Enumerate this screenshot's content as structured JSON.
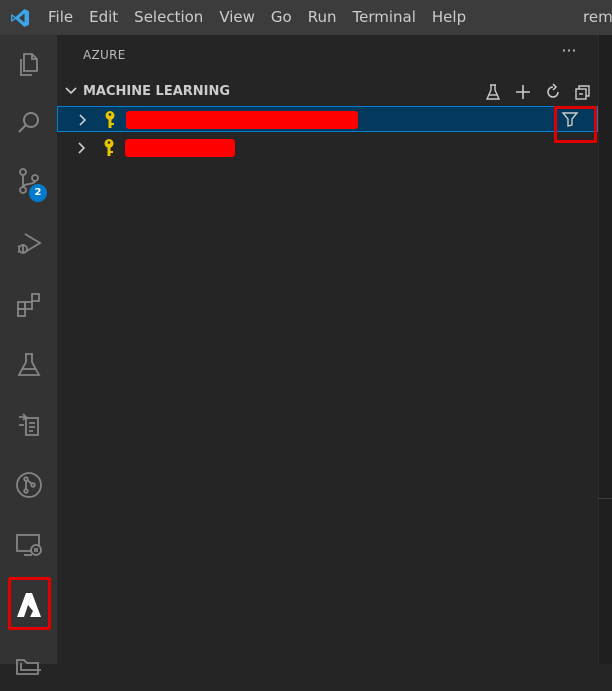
{
  "menubar": {
    "items": [
      "File",
      "Edit",
      "Selection",
      "View",
      "Go",
      "Run",
      "Terminal",
      "Help"
    ],
    "window_title": "remo"
  },
  "activitybar": {
    "items": [
      {
        "name": "explorer",
        "icon": "files-icon"
      },
      {
        "name": "search",
        "icon": "search-icon"
      },
      {
        "name": "source-control",
        "icon": "source-control-icon",
        "badge": "2"
      },
      {
        "name": "run-and-debug",
        "icon": "debug-icon"
      },
      {
        "name": "extensions",
        "icon": "extensions-icon"
      },
      {
        "name": "testing",
        "icon": "beaker-icon"
      },
      {
        "name": "remote-explorer",
        "icon": "remote-explorer-icon"
      },
      {
        "name": "git-graph",
        "icon": "git-graph-icon"
      },
      {
        "name": "remote-connection",
        "icon": "remote-monitor-icon"
      },
      {
        "name": "azure",
        "icon": "azure-icon",
        "highlighted": true
      },
      {
        "name": "folder",
        "icon": "folder-icon"
      }
    ]
  },
  "sidebar": {
    "title": "AZURE",
    "more_actions": "···",
    "section": {
      "title": "MACHINE LEARNING",
      "expanded": true,
      "actions": [
        "beaker-icon",
        "add-icon",
        "refresh-icon",
        "collapse-all-icon"
      ]
    },
    "tree": [
      {
        "label": "",
        "icon": "key-icon",
        "redacted": true,
        "selected": true,
        "show_filter": true
      },
      {
        "label": "",
        "icon": "key-icon",
        "redacted": true,
        "selected": false,
        "show_filter": false
      }
    ]
  },
  "colors": {
    "accent": "#007acc",
    "highlight_box": "#e00000",
    "redaction": "#ff0000",
    "key_icon": "#e8c500",
    "selection_bg": "#04395e"
  }
}
